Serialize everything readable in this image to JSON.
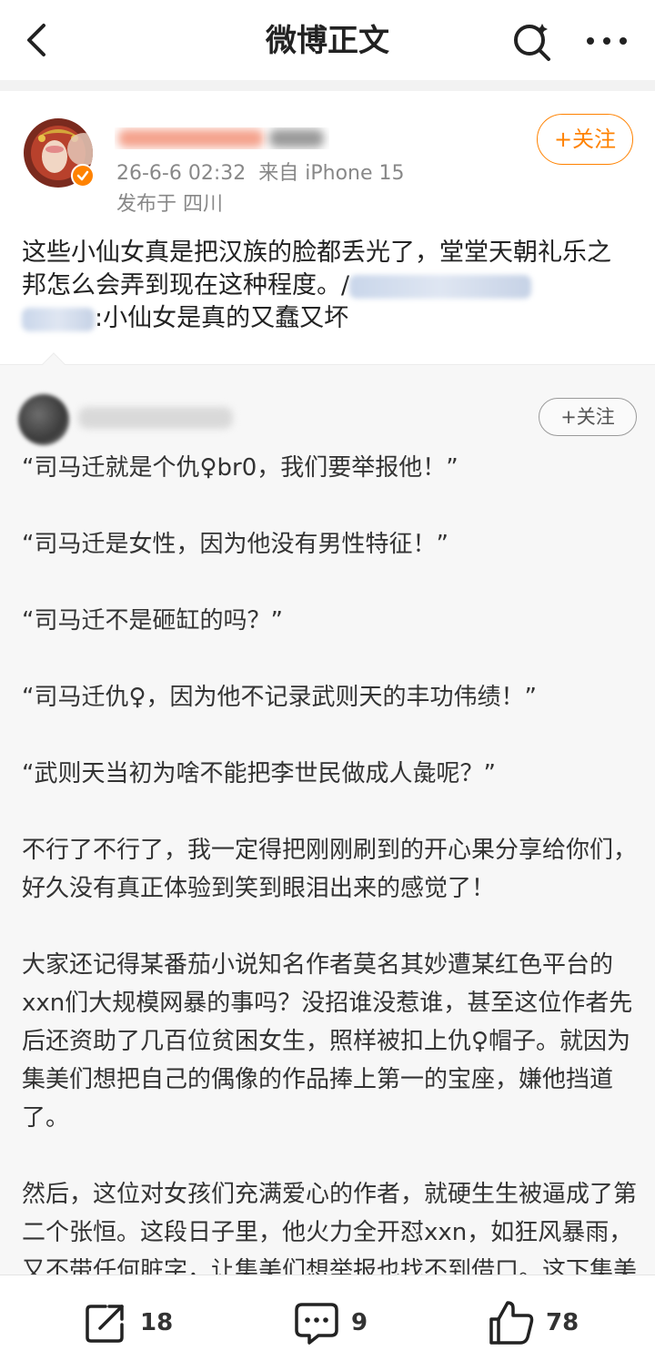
{
  "nav": {
    "title": "微博正文",
    "back_icon": "chevron-left-icon",
    "search_icon": "search-icon",
    "more_icon": "more-dots-icon"
  },
  "post": {
    "timestamp": "26-6-6 02:32",
    "source": "来自 iPhone 15",
    "location": "发布于 四川",
    "follow_label": "+关注",
    "text_part1": "这些小仙女真是把汉族的脸都丢光了，堂堂天朝礼乐之邦怎么会弄到现在这种程度。/",
    "text_part2": ":小仙女是真的又蠢又坏",
    "accent_color": "#ff8200"
  },
  "repost": {
    "follow_label": "+关注",
    "paragraphs": [
      "“司马迁就是个仇♀br0，我们要举报他！”",
      "“司马迁是女性，因为他没有男性特征！”",
      "“司马迁不是砸缸的吗？”",
      "“司马迁仇♀，因为他不记录武则天的丰功伟绩！”",
      "“武则天当初为啥不能把李世民做成人彘呢？”",
      "不行了不行了，我一定得把刚刚刷到的开心果分享给你们，好久没有真正体验到笑到眼泪出来的感觉了！",
      "大家还记得某番茄小说知名作者莫名其妙遭某红色平台的xxn们大规模网暴的事吗？没招谁没惹谁，甚至这位作者先后还资助了几百位贫困女生，照样被扣上仇♀帽子。就因为集美们想把自己的偶像的作品捧上第一的宝座，嫌他挡道了。",
      "然后，这位对女孩们充满爱心的作者，就硬生生被逼成了第二个张恒。这段日子里，他火力全开怼xxn，如狂风暴雨，又不带任何脏字，让集美们想举报也找不到借口。这下集美们知道文化人惹不得了吧？"
    ]
  },
  "actions": {
    "share_count": "18",
    "comment_count": "9",
    "like_count": "78"
  }
}
